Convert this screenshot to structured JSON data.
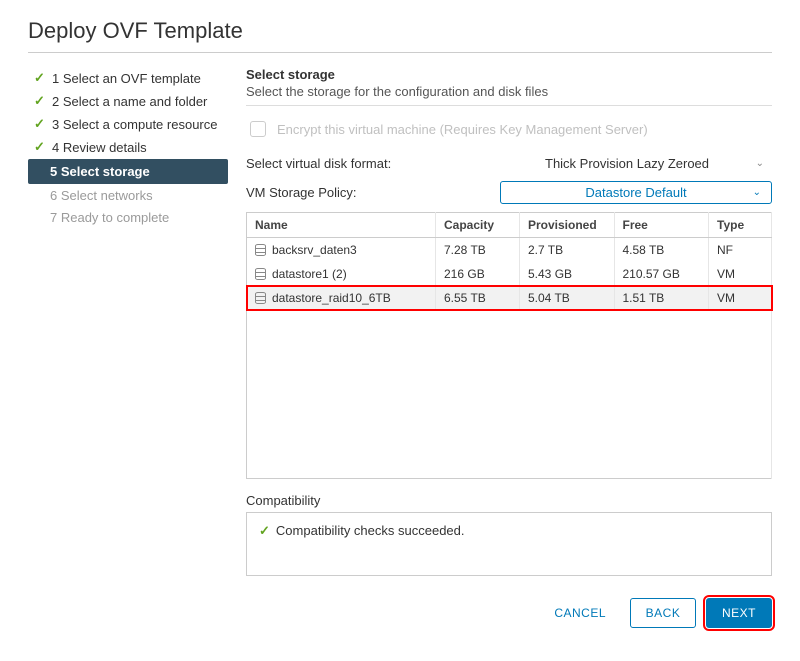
{
  "dialog": {
    "title": "Deploy OVF Template"
  },
  "steps": [
    {
      "label": "1 Select an OVF template",
      "state": "done"
    },
    {
      "label": "2 Select a name and folder",
      "state": "done"
    },
    {
      "label": "3 Select a compute resource",
      "state": "done"
    },
    {
      "label": "4 Review details",
      "state": "done"
    },
    {
      "label": "5 Select storage",
      "state": "active"
    },
    {
      "label": "6 Select networks",
      "state": "future"
    },
    {
      "label": "7 Ready to complete",
      "state": "future"
    }
  ],
  "panel": {
    "heading": "Select storage",
    "subtext": "Select the storage for the configuration and disk files",
    "encrypt_label": "Encrypt this virtual machine (Requires Key Management Server)",
    "disk_format_label": "Select virtual disk format:",
    "disk_format_value": "Thick Provision Lazy Zeroed",
    "policy_label": "VM Storage Policy:",
    "policy_value": "Datastore Default"
  },
  "table": {
    "headers": {
      "name": "Name",
      "capacity": "Capacity",
      "provisioned": "Provisioned",
      "free": "Free",
      "type": "Type"
    },
    "rows": [
      {
        "name": "backsrv_daten3",
        "capacity": "7.28 TB",
        "provisioned": "2.7 TB",
        "free": "4.58 TB",
        "type": "NF",
        "selected": false
      },
      {
        "name": "datastore1 (2)",
        "capacity": "216 GB",
        "provisioned": "5.43 GB",
        "free": "210.57 GB",
        "type": "VM",
        "selected": false
      },
      {
        "name": "datastore_raid10_6TB",
        "capacity": "6.55 TB",
        "provisioned": "5.04 TB",
        "free": "1.51 TB",
        "type": "VM",
        "selected": true
      }
    ]
  },
  "compat": {
    "label": "Compatibility",
    "message": "Compatibility checks succeeded."
  },
  "buttons": {
    "cancel": "CANCEL",
    "back": "BACK",
    "next": "NEXT"
  }
}
